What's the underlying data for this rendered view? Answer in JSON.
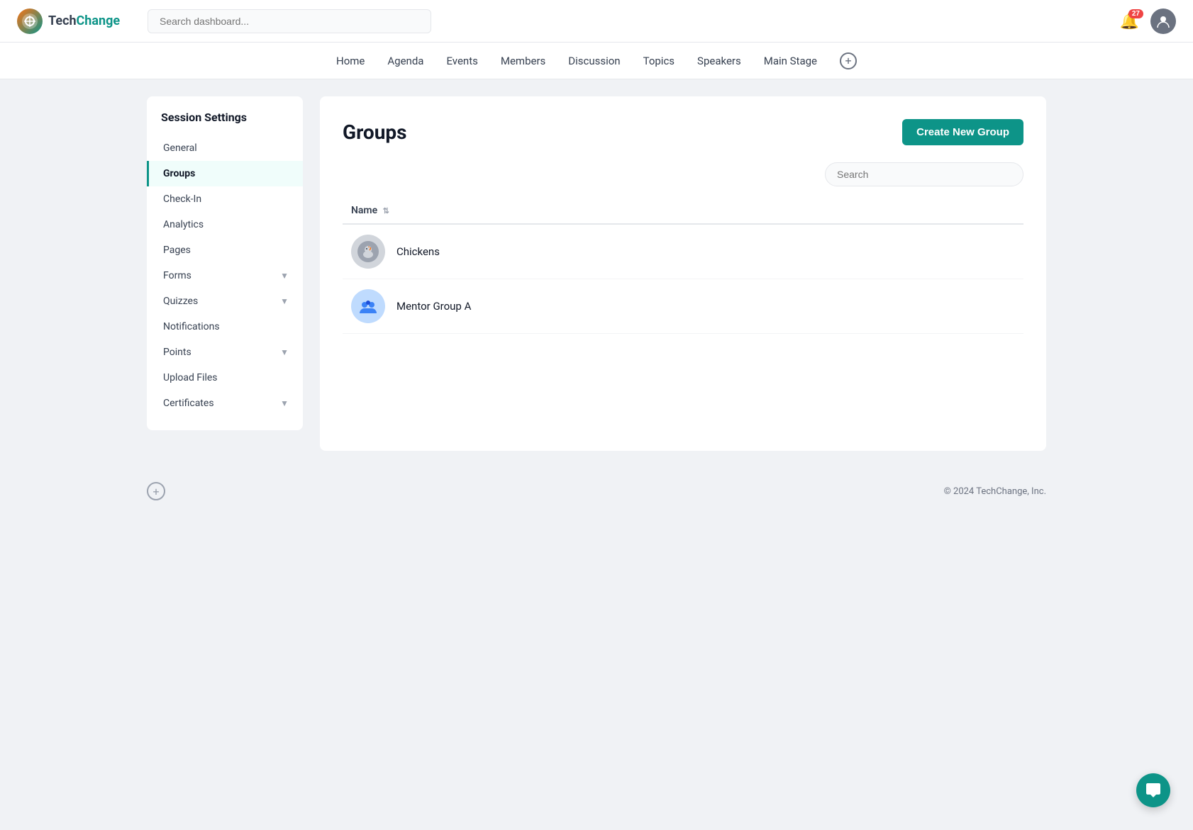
{
  "brand": {
    "name_part1": "Tech",
    "name_part2": "Change",
    "logo_emoji": "🌐"
  },
  "topbar": {
    "search_placeholder": "Search dashboard...",
    "notification_count": "27"
  },
  "secondary_nav": {
    "items": [
      {
        "label": "Home",
        "id": "home"
      },
      {
        "label": "Agenda",
        "id": "agenda"
      },
      {
        "label": "Events",
        "id": "events"
      },
      {
        "label": "Members",
        "id": "members"
      },
      {
        "label": "Discussion",
        "id": "discussion"
      },
      {
        "label": "Topics",
        "id": "topics"
      },
      {
        "label": "Speakers",
        "id": "speakers"
      },
      {
        "label": "Main Stage",
        "id": "main-stage"
      }
    ]
  },
  "sidebar": {
    "title": "Session Settings",
    "items": [
      {
        "label": "General",
        "id": "general",
        "active": false,
        "has_chevron": false
      },
      {
        "label": "Groups",
        "id": "groups",
        "active": true,
        "has_chevron": false
      },
      {
        "label": "Check-In",
        "id": "check-in",
        "active": false,
        "has_chevron": false
      },
      {
        "label": "Analytics",
        "id": "analytics",
        "active": false,
        "has_chevron": false
      },
      {
        "label": "Pages",
        "id": "pages",
        "active": false,
        "has_chevron": false
      },
      {
        "label": "Forms",
        "id": "forms",
        "active": false,
        "has_chevron": true
      },
      {
        "label": "Quizzes",
        "id": "quizzes",
        "active": false,
        "has_chevron": true
      },
      {
        "label": "Notifications",
        "id": "notifications",
        "active": false,
        "has_chevron": false
      },
      {
        "label": "Points",
        "id": "points",
        "active": false,
        "has_chevron": true
      },
      {
        "label": "Upload Files",
        "id": "upload-files",
        "active": false,
        "has_chevron": false
      },
      {
        "label": "Certificates",
        "id": "certificates",
        "active": false,
        "has_chevron": true
      }
    ]
  },
  "main": {
    "page_title": "Groups",
    "create_button_label": "Create New Group",
    "search_placeholder": "Search",
    "table_col_name": "Name",
    "groups": [
      {
        "id": "chickens",
        "name": "Chickens",
        "avatar_type": "chicken"
      },
      {
        "id": "mentor-group-a",
        "name": "Mentor Group A",
        "avatar_type": "mentor"
      }
    ]
  },
  "footer": {
    "copyright": "© 2024 TechChange, Inc."
  }
}
